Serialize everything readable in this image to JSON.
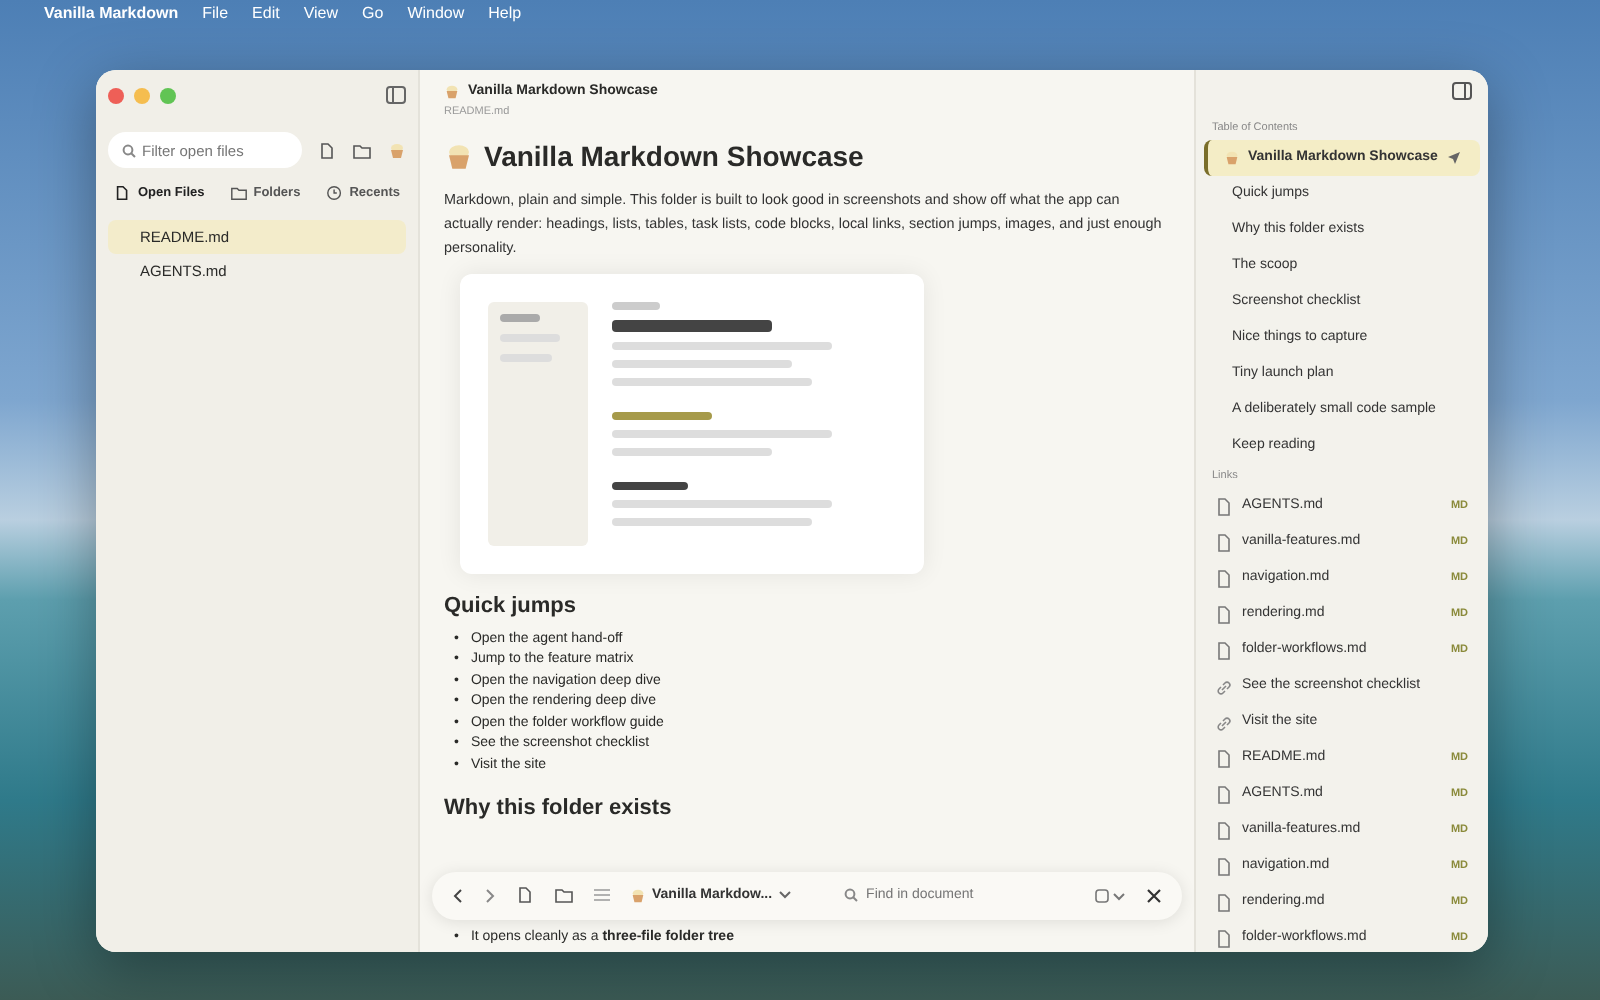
{
  "menu_bar": {
    "app_name": "Vanilla Markdown",
    "menus": [
      "File",
      "Edit",
      "View",
      "Go",
      "Window",
      "Help"
    ]
  },
  "sidebar": {
    "filter_placeholder": "Filter open files",
    "tabs": [
      {
        "label": "Open Files",
        "kind": "files",
        "selected": true
      },
      {
        "label": "Folders",
        "kind": "folder",
        "selected": false
      },
      {
        "label": "Recents",
        "kind": "clock",
        "selected": false
      }
    ],
    "files": [
      {
        "name": "README.md",
        "selected": true
      },
      {
        "name": "AGENTS.md",
        "selected": false
      }
    ]
  },
  "document": {
    "title": "Vanilla Markdown Showcase",
    "filename": "README.md",
    "heading": "Vanilla Markdown Showcase",
    "intro": "Markdown, plain and simple. This folder is built to look good in screenshots and show off what the app can actually render: headings, lists, tables, task lists, code blocks, local links, section jumps, images, and just enough personality.",
    "bullet_marker": "•",
    "sections": [
      {
        "heading": "Quick jumps",
        "links": [
          "Open the agent hand-off",
          "Jump to the feature matrix",
          "Open the navigation deep dive",
          "Open the rendering deep dive",
          "Open the folder workflow guide",
          "See the screenshot checklist",
          "Visit the site"
        ]
      },
      {
        "heading": "Why this folder exists",
        "bullets": [
          "It opens cleanly as a **three-file folder tree**"
        ]
      }
    ]
  },
  "toolbar": {
    "document_menu": "Vanilla Markdow...",
    "find_placeholder": "Find in document"
  },
  "outline": {
    "toc_title": "Table of Contents",
    "toc": [
      {
        "label": "Vanilla Markdown Showcase",
        "selected": true
      },
      {
        "label": "Quick jumps",
        "selected": false
      },
      {
        "label": "Why this folder exists",
        "selected": false
      },
      {
        "label": "The scoop",
        "selected": false
      },
      {
        "label": "Screenshot checklist",
        "selected": false
      },
      {
        "label": "Nice things to capture",
        "selected": false
      },
      {
        "label": "Tiny launch plan",
        "selected": false
      },
      {
        "label": "A deliberately small code sample",
        "selected": false
      },
      {
        "label": "Keep reading",
        "selected": false
      }
    ],
    "links_title": "Links",
    "links": [
      {
        "kind": "file",
        "label": "AGENTS.md",
        "badge": "MD"
      },
      {
        "kind": "file",
        "label": "vanilla-features.md",
        "badge": "MD"
      },
      {
        "kind": "file",
        "label": "navigation.md",
        "badge": "MD"
      },
      {
        "kind": "file",
        "label": "rendering.md",
        "badge": "MD"
      },
      {
        "kind": "file",
        "label": "folder-workflows.md",
        "badge": "MD"
      },
      {
        "kind": "link",
        "label": "See the screenshot checklist"
      },
      {
        "kind": "link",
        "label": "Visit the site"
      },
      {
        "kind": "file",
        "label": "README.md",
        "badge": "MD"
      },
      {
        "kind": "file",
        "label": "AGENTS.md",
        "badge": "MD"
      },
      {
        "kind": "file",
        "label": "vanilla-features.md",
        "badge": "MD"
      },
      {
        "kind": "file",
        "label": "navigation.md",
        "badge": "MD"
      },
      {
        "kind": "file",
        "label": "rendering.md",
        "badge": "MD"
      },
      {
        "kind": "file",
        "label": "folder-workflows.md",
        "badge": "MD"
      }
    ]
  }
}
